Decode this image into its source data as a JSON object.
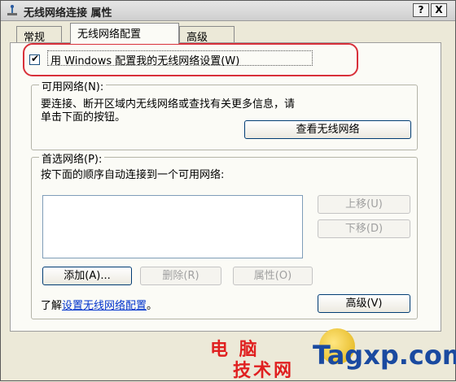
{
  "window": {
    "title": "无线网络连接 属性",
    "help_button": "?",
    "close_button": "X"
  },
  "tabs": [
    {
      "label": "常规"
    },
    {
      "label": "无线网络配置"
    },
    {
      "label": "高级"
    }
  ],
  "checkbox": {
    "label": "用 Windows 配置我的无线网络设置(W)",
    "checked": true
  },
  "available_networks": {
    "group_label": "可用网络(N):",
    "description_line1": "要连接、断开区域内无线网络或查找有关更多信息，请",
    "description_line2": "单击下面的按钮。",
    "view_button": "查看无线网络"
  },
  "preferred_networks": {
    "group_label": "首选网络(P):",
    "description": "按下面的顺序自动连接到一个可用网络:",
    "move_up_button": "上移(U)",
    "move_down_button": "下移(D)",
    "add_button": "添加(A)...",
    "remove_button": "删除(R)",
    "properties_button": "属性(O)"
  },
  "footer": {
    "learn_prefix": "了解",
    "learn_link": "设置无线网络配置",
    "learn_suffix": "。",
    "advanced_button": "高级(V)"
  },
  "watermark": {
    "line1": "电 脑",
    "line2": "技术网",
    "domain": "Tagxp.com"
  },
  "colors": {
    "highlight": "#d8303a",
    "link": "#0033cc",
    "watermark_red": "#e02020",
    "watermark_blue": "#1a4aa0"
  }
}
